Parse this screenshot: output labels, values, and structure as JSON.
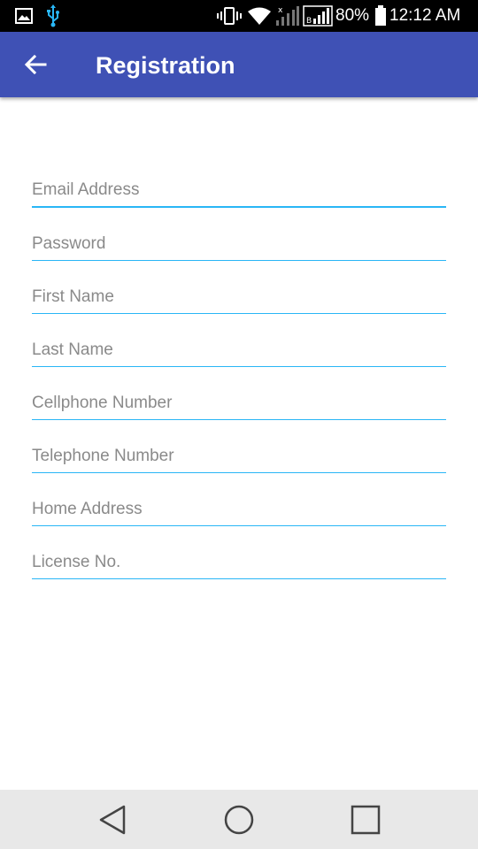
{
  "status_bar": {
    "battery_percent": "80%",
    "time": "12:12 AM"
  },
  "app_bar": {
    "title": "Registration"
  },
  "form": {
    "fields": [
      {
        "placeholder": "Email Address",
        "value": ""
      },
      {
        "placeholder": "Password",
        "value": ""
      },
      {
        "placeholder": "First Name",
        "value": ""
      },
      {
        "placeholder": "Last Name",
        "value": ""
      },
      {
        "placeholder": "Cellphone Number",
        "value": ""
      },
      {
        "placeholder": "Telephone Number",
        "value": ""
      },
      {
        "placeholder": "Home Address",
        "value": ""
      },
      {
        "placeholder": "License No.",
        "value": ""
      }
    ]
  },
  "colors": {
    "app_bar": "#3f51b5",
    "underline": "#29b6f6",
    "placeholder": "#8a8a8a",
    "nav_bar": "#e8e8e8"
  },
  "icons": {
    "status": [
      "gallery-icon",
      "usb-icon",
      "vibrate-icon",
      "wifi-icon",
      "signal-x-icon",
      "signal-icon",
      "battery-icon"
    ],
    "app_bar": [
      "back-arrow-icon"
    ],
    "nav": [
      "back-triangle-icon",
      "home-circle-icon",
      "recents-square-icon"
    ]
  }
}
